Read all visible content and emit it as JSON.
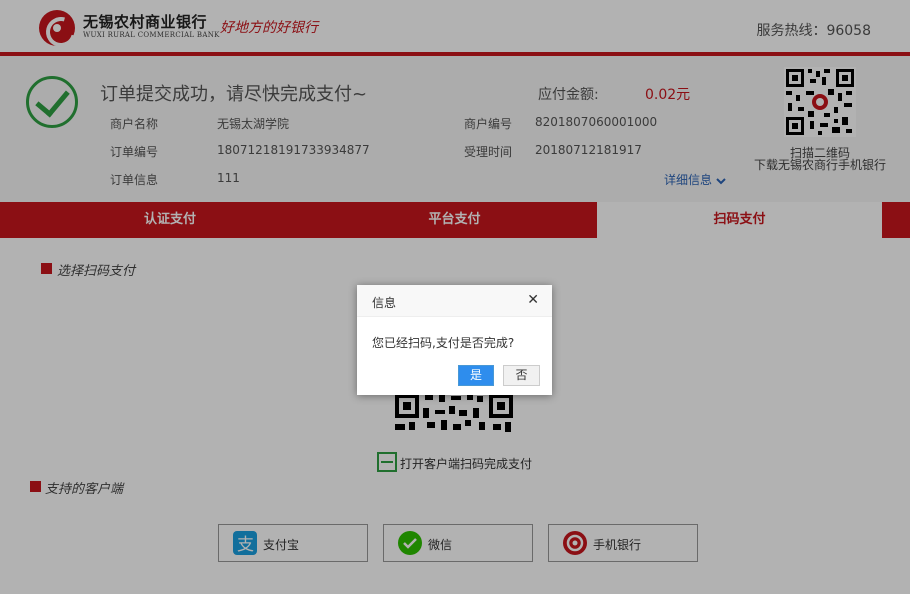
{
  "header": {
    "bank_name": "无锡农村商业银行",
    "bank_name_en": "WUXI RURAL COMMERCIAL BANK",
    "slogan": "好地方的好银行",
    "hotline": "服务热线：96058"
  },
  "order": {
    "success_message": "订单提交成功，请尽快完成支付~",
    "amount_label": "应付金额:",
    "amount_value": "0.02元",
    "fields": [
      {
        "label": "商户名称",
        "value": "无锡太湖学院"
      },
      {
        "label": "商户编号",
        "value": "8201807060001000"
      },
      {
        "label": "订单编号",
        "value": "18071218191733934877"
      },
      {
        "label": "受理时间",
        "value": "20180712181917"
      },
      {
        "label": "订单信息",
        "value": "111"
      }
    ],
    "detail_link": "详细信息",
    "qr_caption_1": "扫描二维码",
    "qr_caption_2": "下载无锡农商行手机银行"
  },
  "tabs": [
    {
      "label": "认证支付"
    },
    {
      "label": "平台支付"
    },
    {
      "label": "扫码支付"
    }
  ],
  "scan": {
    "section_title": "选择扫码支付",
    "hint": "打开客户端扫码完成支付"
  },
  "clients": {
    "section_title": "支持的客户端",
    "items": [
      {
        "label": "支付宝",
        "icon": "alipay-icon",
        "color": "#1a9fe0"
      },
      {
        "label": "微信",
        "icon": "wechat-icon",
        "color": "#2dc100"
      },
      {
        "label": "手机银行",
        "icon": "bank-logo-icon",
        "color": "#c8161d"
      }
    ]
  },
  "dialog": {
    "title": "信息",
    "message": "您已经扫码,支付是否完成?",
    "yes_label": "是",
    "no_label": "否"
  },
  "colors": {
    "brand_red": "#c8161d",
    "success_green": "#2ea043",
    "link_blue": "#2b63b5",
    "dialog_button_blue": "#2e8ded"
  }
}
